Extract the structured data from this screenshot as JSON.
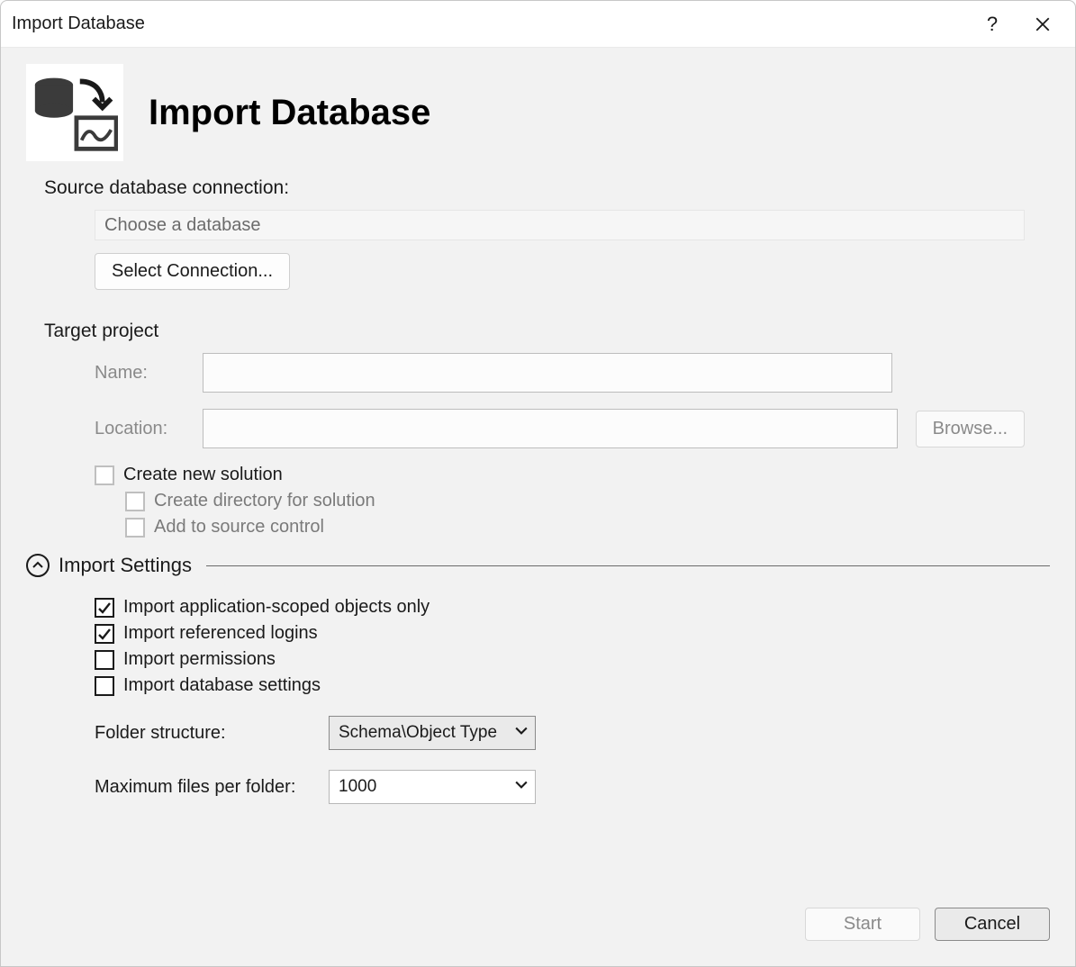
{
  "titlebar": {
    "title": "Import Database"
  },
  "header": {
    "heading": "Import Database"
  },
  "source": {
    "section_label": "Source database connection:",
    "placeholder": "Choose a database",
    "select_connection_label": "Select Connection..."
  },
  "target": {
    "section_label": "Target project",
    "name_label": "Name:",
    "name_value": "",
    "location_label": "Location:",
    "location_value": "",
    "browse_label": "Browse...",
    "create_new_solution_label": "Create new solution",
    "create_directory_label": "Create directory for solution",
    "add_source_control_label": "Add to source control"
  },
  "import_settings": {
    "header_label": "Import Settings",
    "opts": {
      "app_scoped": "Import application-scoped objects only",
      "ref_logins": "Import referenced logins",
      "permissions": "Import permissions",
      "db_settings": "Import database settings"
    },
    "folder_structure_label": "Folder structure:",
    "folder_structure_value": "Schema\\Object Type",
    "max_files_label": "Maximum files per folder:",
    "max_files_value": "1000"
  },
  "footer": {
    "start_label": "Start",
    "cancel_label": "Cancel"
  }
}
